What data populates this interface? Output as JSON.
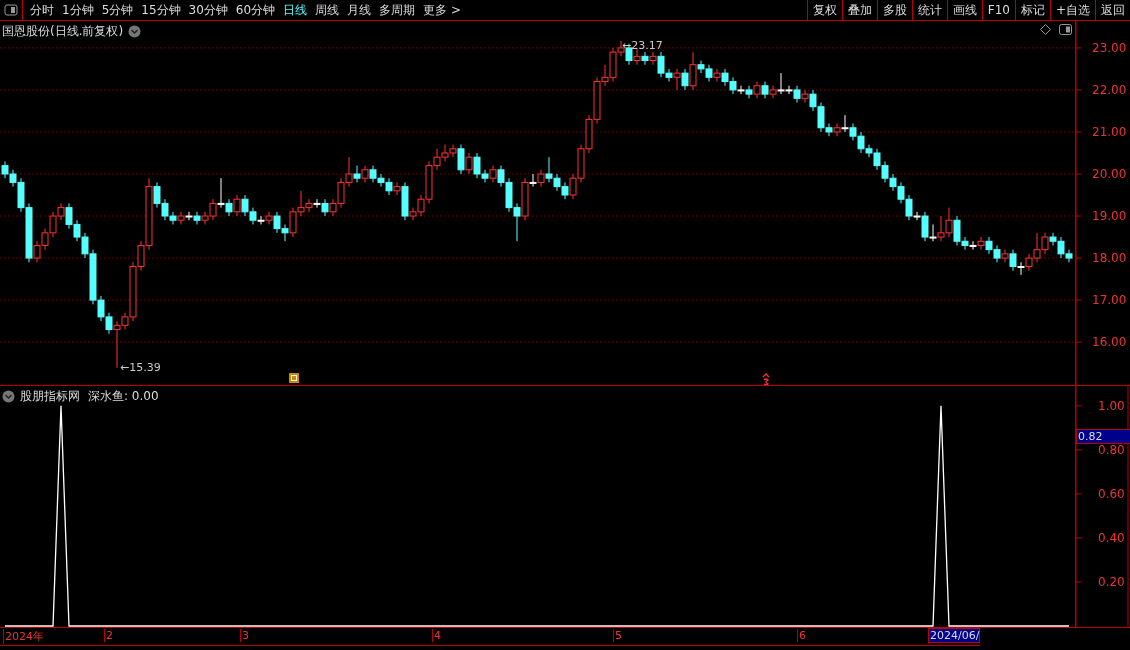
{
  "toolbar": {
    "tabs": [
      {
        "label": "分时",
        "selected": false
      },
      {
        "label": "1分钟",
        "selected": false
      },
      {
        "label": "5分钟",
        "selected": false
      },
      {
        "label": "15分钟",
        "selected": false
      },
      {
        "label": "30分钟",
        "selected": false
      },
      {
        "label": "60分钟",
        "selected": false
      },
      {
        "label": "日线",
        "selected": true
      },
      {
        "label": "周线",
        "selected": false
      },
      {
        "label": "月线",
        "selected": false
      },
      {
        "label": "多周期",
        "selected": false
      },
      {
        "label": "更多 >",
        "selected": false
      }
    ],
    "buttons": [
      "复权",
      "叠加",
      "多股",
      "统计",
      "画线",
      "F10",
      "标记",
      "+自选",
      "返回"
    ]
  },
  "price_chart": {
    "title": "国恩股份(日线.前复权)",
    "high_label": "←23.17",
    "low_label": "←15.39",
    "chart_data": {
      "type": "candlestick",
      "grid": true,
      "ylim": [
        14.98,
        23.64
      ],
      "yticks": [
        {
          "value": 23,
          "label": "23.00"
        },
        {
          "value": 22,
          "label": "22.00"
        },
        {
          "value": 21,
          "label": "21.00"
        },
        {
          "value": 20,
          "label": "20.00"
        },
        {
          "value": 19,
          "label": "19.00"
        },
        {
          "value": 18,
          "label": "18.00"
        },
        {
          "value": 17,
          "label": "17.00"
        },
        {
          "value": 16,
          "label": "16.00"
        }
      ],
      "ohlc": [
        [
          20.2,
          20.3,
          19.9,
          20.0
        ],
        [
          20.0,
          20.1,
          19.7,
          19.8
        ],
        [
          19.8,
          19.9,
          19.1,
          19.2
        ],
        [
          19.2,
          19.3,
          17.9,
          18.0
        ],
        [
          18.0,
          18.4,
          17.9,
          18.3
        ],
        [
          18.3,
          18.7,
          18.2,
          18.6
        ],
        [
          18.6,
          19.1,
          18.5,
          19.0
        ],
        [
          19.0,
          19.3,
          18.9,
          19.2
        ],
        [
          19.2,
          19.3,
          18.7,
          18.8
        ],
        [
          18.8,
          18.9,
          18.4,
          18.5
        ],
        [
          18.5,
          18.6,
          18.0,
          18.1
        ],
        [
          18.1,
          18.2,
          16.9,
          17.0
        ],
        [
          17.0,
          17.1,
          16.5,
          16.6
        ],
        [
          16.6,
          16.7,
          16.2,
          16.3
        ],
        [
          16.3,
          16.5,
          15.39,
          16.4
        ],
        [
          16.4,
          16.7,
          16.3,
          16.6
        ],
        [
          16.6,
          17.9,
          16.5,
          17.8
        ],
        [
          17.8,
          18.4,
          17.7,
          18.3
        ],
        [
          18.3,
          19.9,
          18.2,
          19.7
        ],
        [
          19.7,
          19.8,
          19.2,
          19.3
        ],
        [
          19.3,
          19.4,
          18.9,
          19.0
        ],
        [
          19.0,
          19.1,
          18.8,
          18.9
        ],
        [
          18.9,
          19.1,
          18.8,
          19.0
        ],
        [
          19.0,
          19.1,
          18.9,
          19.0
        ],
        [
          19.0,
          19.1,
          18.8,
          18.9
        ],
        [
          18.9,
          19.1,
          18.8,
          19.0
        ],
        [
          19.0,
          19.4,
          18.9,
          19.3
        ],
        [
          19.3,
          19.9,
          19.2,
          19.3
        ],
        [
          19.3,
          19.4,
          19.0,
          19.1
        ],
        [
          19.1,
          19.5,
          19.0,
          19.4
        ],
        [
          19.4,
          19.5,
          19.0,
          19.1
        ],
        [
          19.1,
          19.2,
          18.8,
          18.9
        ],
        [
          18.9,
          19.0,
          18.8,
          18.9
        ],
        [
          18.9,
          19.1,
          18.8,
          19.0
        ],
        [
          19.0,
          19.1,
          18.6,
          18.7
        ],
        [
          18.7,
          18.8,
          18.4,
          18.6
        ],
        [
          18.6,
          19.2,
          18.5,
          19.1
        ],
        [
          19.1,
          19.6,
          19.0,
          19.2
        ],
        [
          19.2,
          19.4,
          19.1,
          19.3
        ],
        [
          19.3,
          19.4,
          19.2,
          19.3
        ],
        [
          19.3,
          19.4,
          19.0,
          19.1
        ],
        [
          19.1,
          19.4,
          19.0,
          19.3
        ],
        [
          19.3,
          19.9,
          19.2,
          19.8
        ],
        [
          19.8,
          20.4,
          19.7,
          20.0
        ],
        [
          20.0,
          20.2,
          19.8,
          19.9
        ],
        [
          19.9,
          20.2,
          19.8,
          20.1
        ],
        [
          20.1,
          20.2,
          19.8,
          19.9
        ],
        [
          19.9,
          20.0,
          19.7,
          19.8
        ],
        [
          19.8,
          19.9,
          19.5,
          19.6
        ],
        [
          19.6,
          19.8,
          19.5,
          19.7
        ],
        [
          19.7,
          19.8,
          18.9,
          19.0
        ],
        [
          19.0,
          19.2,
          18.9,
          19.1
        ],
        [
          19.1,
          19.5,
          19.0,
          19.4
        ],
        [
          19.4,
          20.3,
          19.3,
          20.2
        ],
        [
          20.2,
          20.6,
          20.1,
          20.4
        ],
        [
          20.4,
          20.7,
          20.3,
          20.5
        ],
        [
          20.5,
          20.7,
          20.4,
          20.6
        ],
        [
          20.6,
          20.7,
          20.0,
          20.1
        ],
        [
          20.1,
          20.5,
          20.0,
          20.4
        ],
        [
          20.4,
          20.5,
          19.9,
          20.0
        ],
        [
          20.0,
          20.1,
          19.8,
          19.9
        ],
        [
          19.9,
          20.2,
          19.8,
          20.1
        ],
        [
          20.1,
          20.2,
          19.7,
          19.8
        ],
        [
          19.8,
          19.9,
          19.1,
          19.2
        ],
        [
          19.2,
          19.3,
          18.4,
          19.0
        ],
        [
          19.0,
          19.9,
          18.9,
          19.8
        ],
        [
          19.8,
          20.0,
          19.7,
          19.8
        ],
        [
          19.8,
          20.1,
          19.7,
          20.0
        ],
        [
          20.0,
          20.4,
          19.8,
          19.9
        ],
        [
          19.9,
          20.0,
          19.6,
          19.7
        ],
        [
          19.7,
          19.8,
          19.4,
          19.5
        ],
        [
          19.5,
          20.0,
          19.4,
          19.9
        ],
        [
          19.9,
          20.7,
          19.8,
          20.6
        ],
        [
          20.6,
          21.4,
          20.5,
          21.3
        ],
        [
          21.3,
          22.3,
          21.2,
          22.2
        ],
        [
          22.2,
          22.6,
          22.1,
          22.3
        ],
        [
          22.3,
          23.0,
          22.2,
          22.9
        ],
        [
          22.9,
          23.17,
          22.8,
          23.0
        ],
        [
          23.0,
          23.1,
          22.6,
          22.7
        ],
        [
          22.7,
          23.0,
          22.6,
          22.8
        ],
        [
          22.8,
          22.9,
          22.6,
          22.7
        ],
        [
          22.7,
          22.9,
          22.6,
          22.8
        ],
        [
          22.8,
          22.9,
          22.3,
          22.4
        ],
        [
          22.4,
          22.5,
          22.2,
          22.3
        ],
        [
          22.3,
          22.5,
          22.0,
          22.4
        ],
        [
          22.4,
          22.5,
          22.0,
          22.1
        ],
        [
          22.1,
          22.9,
          22.0,
          22.6
        ],
        [
          22.6,
          22.7,
          22.4,
          22.5
        ],
        [
          22.5,
          22.6,
          22.2,
          22.3
        ],
        [
          22.3,
          22.5,
          22.2,
          22.4
        ],
        [
          22.4,
          22.5,
          22.1,
          22.2
        ],
        [
          22.2,
          22.3,
          21.9,
          22.0
        ],
        [
          22.0,
          22.1,
          21.9,
          22.0
        ],
        [
          22.0,
          22.1,
          21.8,
          21.9
        ],
        [
          21.9,
          22.2,
          21.8,
          22.1
        ],
        [
          22.1,
          22.2,
          21.8,
          21.9
        ],
        [
          21.9,
          22.1,
          21.8,
          22.0
        ],
        [
          22.0,
          22.4,
          21.9,
          22.0
        ],
        [
          22.0,
          22.1,
          21.9,
          22.0
        ],
        [
          22.0,
          22.1,
          21.7,
          21.8
        ],
        [
          21.8,
          22.0,
          21.7,
          21.9
        ],
        [
          21.9,
          22.0,
          21.5,
          21.6
        ],
        [
          21.6,
          21.7,
          21.0,
          21.1
        ],
        [
          21.1,
          21.2,
          20.9,
          21.0
        ],
        [
          21.0,
          21.2,
          20.9,
          21.1
        ],
        [
          21.1,
          21.4,
          21.0,
          21.1
        ],
        [
          21.1,
          21.2,
          20.8,
          20.9
        ],
        [
          20.9,
          21.0,
          20.5,
          20.6
        ],
        [
          20.6,
          20.7,
          20.4,
          20.5
        ],
        [
          20.5,
          20.6,
          20.1,
          20.2
        ],
        [
          20.2,
          20.3,
          19.8,
          19.9
        ],
        [
          19.9,
          20.0,
          19.6,
          19.7
        ],
        [
          19.7,
          19.8,
          19.3,
          19.4
        ],
        [
          19.4,
          19.5,
          18.9,
          19.0
        ],
        [
          19.0,
          19.1,
          18.9,
          19.0
        ],
        [
          19.0,
          19.1,
          18.4,
          18.5
        ],
        [
          18.5,
          18.8,
          18.4,
          18.5
        ],
        [
          18.5,
          19.0,
          18.4,
          18.6
        ],
        [
          18.6,
          19.2,
          18.5,
          18.9
        ],
        [
          18.9,
          19.0,
          18.3,
          18.4
        ],
        [
          18.4,
          18.5,
          18.2,
          18.3
        ],
        [
          18.3,
          18.4,
          18.2,
          18.3
        ],
        [
          18.3,
          18.5,
          18.2,
          18.4
        ],
        [
          18.4,
          18.5,
          18.1,
          18.2
        ],
        [
          18.2,
          18.3,
          17.9,
          18.0
        ],
        [
          18.0,
          18.2,
          17.9,
          18.1
        ],
        [
          18.1,
          18.2,
          17.7,
          17.8
        ],
        [
          17.8,
          17.9,
          17.6,
          17.8
        ],
        [
          17.8,
          18.1,
          17.7,
          18.0
        ],
        [
          18.0,
          18.6,
          17.9,
          18.2
        ],
        [
          18.2,
          18.6,
          18.1,
          18.5
        ],
        [
          18.5,
          18.6,
          18.3,
          18.4
        ],
        [
          18.4,
          18.5,
          18.0,
          18.1
        ],
        [
          18.1,
          18.2,
          17.9,
          18.0
        ]
      ]
    }
  },
  "indicator": {
    "title": "股朋指标网",
    "reading": ": 0.00",
    "cursor_value": "0.82",
    "chart_data": {
      "type": "line",
      "ylim": [
        0,
        1.09
      ],
      "yticks": [
        {
          "value": 0.2,
          "label": "0.20"
        },
        {
          "value": 0.4,
          "label": "0.40"
        },
        {
          "value": 0.6,
          "label": "0.60"
        },
        {
          "value": 0.8,
          "label": "0.80"
        },
        {
          "value": 1,
          "label": "1.00"
        }
      ],
      "series": [
        {
          "name": "深水鱼",
          "color": "#ffffff",
          "values": [
            0,
            0,
            0,
            0,
            0,
            0,
            0,
            1,
            0,
            0,
            0,
            0,
            0,
            0,
            0,
            0,
            0,
            0,
            0,
            0,
            0,
            0,
            0,
            0,
            0,
            0,
            0,
            0,
            0,
            0,
            0,
            0,
            0,
            0,
            0,
            0,
            0,
            0,
            0,
            0,
            0,
            0,
            0,
            0,
            0,
            0,
            0,
            0,
            0,
            0,
            0,
            0,
            0,
            0,
            0,
            0,
            0,
            0,
            0,
            0,
            0,
            0,
            0,
            0,
            0,
            0,
            0,
            0,
            0,
            0,
            0,
            0,
            0,
            0,
            0,
            0,
            0,
            0,
            0,
            0,
            0,
            0,
            0,
            0,
            0,
            0,
            0,
            0,
            0,
            0,
            0,
            0,
            0,
            0,
            0,
            0,
            0,
            0,
            0,
            0,
            0,
            0,
            0,
            0,
            0,
            0,
            0,
            0,
            0,
            0,
            0,
            0,
            0,
            0,
            0,
            0,
            0,
            1,
            0,
            0,
            0,
            0,
            0,
            0,
            0,
            0,
            0,
            0,
            0,
            0,
            0,
            0,
            0,
            0
          ]
        }
      ]
    }
  },
  "timeline": [
    {
      "text": "2024年",
      "selected": false
    },
    {
      "text": "2",
      "selected": false
    },
    {
      "text": "3",
      "selected": false
    },
    {
      "text": "4",
      "selected": false
    },
    {
      "text": "5",
      "selected": false
    },
    {
      "text": "6",
      "selected": false
    },
    {
      "text": "2024/06/",
      "selected": true
    }
  ]
}
